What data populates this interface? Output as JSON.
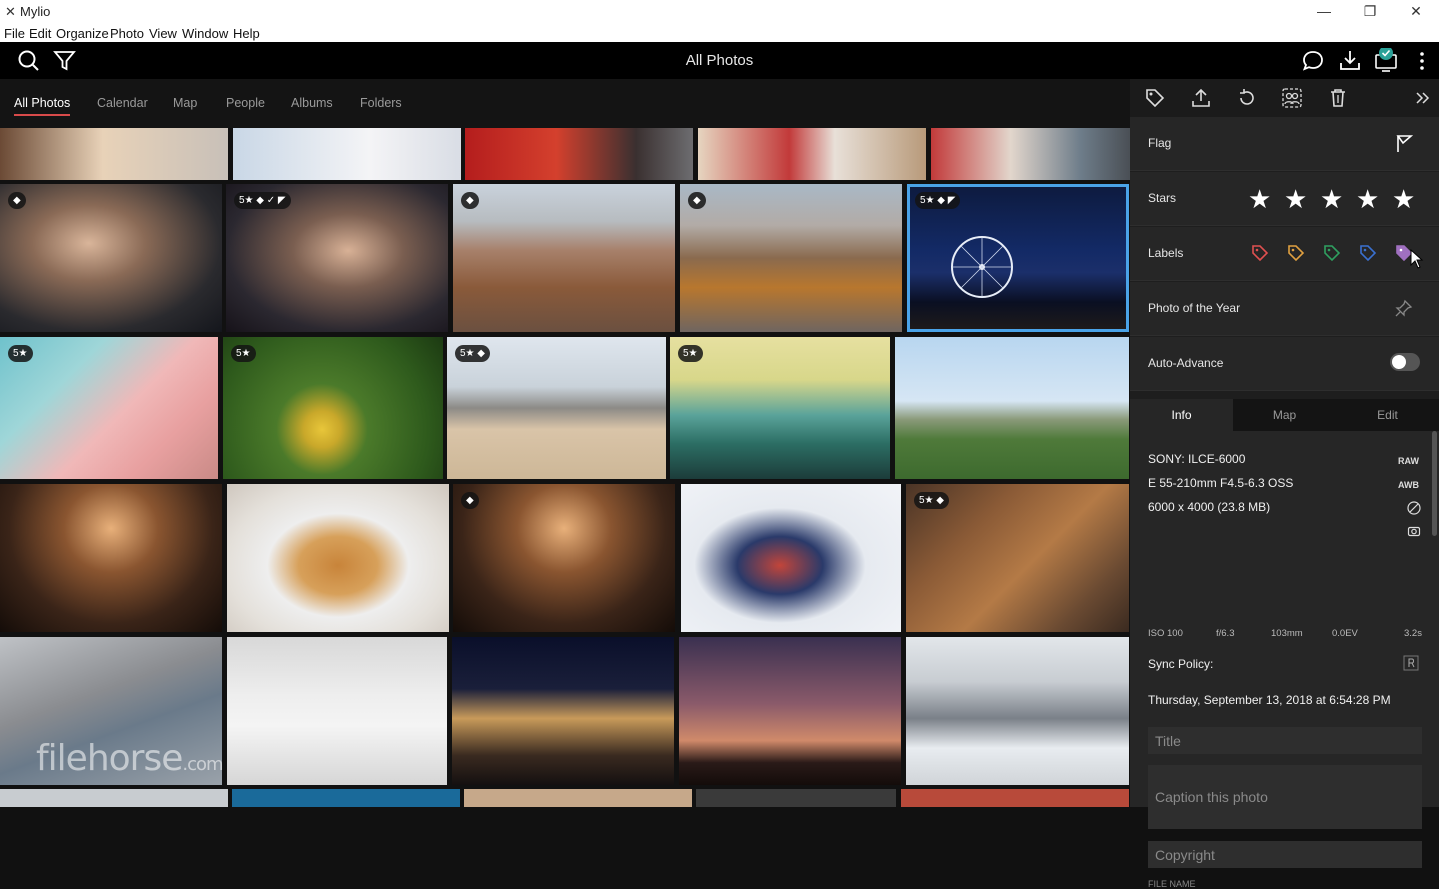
{
  "window": {
    "app_name": "Mylio",
    "minimize": "—",
    "maximize": "❐",
    "close": "✕"
  },
  "menu": [
    "File",
    "Edit",
    "Organize",
    "Photo",
    "View",
    "Window",
    "Help"
  ],
  "header": {
    "title": "All Photos"
  },
  "tabs": [
    "All Photos",
    "Calendar",
    "Map",
    "People",
    "Albums",
    "Folders"
  ],
  "panel": {
    "flag_label": "Flag",
    "stars_label": "Stars",
    "labels_label": "Labels",
    "poty_label": "Photo of the Year",
    "auto_advance_label": "Auto-Advance",
    "label_colors": [
      "#e05050",
      "#e0a040",
      "#2fa060",
      "#3a70d0",
      "#a070c0"
    ],
    "subtabs": [
      "Info",
      "Map",
      "Edit"
    ],
    "info": {
      "camera": "SONY: ILCE-6000",
      "lens": "E 55-210mm F4.5-6.3 OSS",
      "resolution": "6000 x 4000 (23.8 MB)",
      "raw": "RAW",
      "awb": "AWB",
      "iso": "ISO 100",
      "fstop": "f/6.3",
      "focal": "103mm",
      "ev": "0.0EV",
      "shutter": "3.2s",
      "sync_label": "Sync Policy:",
      "date": "Thursday, September 13, 2018 at 6:54:28 PM",
      "title_placeholder": "Title",
      "caption_placeholder": "Caption this photo",
      "copyright_placeholder": "Copyright",
      "filename_label": "FILE NAME"
    }
  },
  "badges": {
    "r1c2": "5★ ◆ ✓ ◤",
    "r1c5": "5★ ◆ ◤",
    "r2c1": "5★",
    "r2c2": "5★",
    "r2c3": "5★ ◆",
    "r2c4": "5★",
    "r3c5": "5★ ◆",
    "tag_only": "◆"
  },
  "watermark": {
    "brand": "filehorse",
    "domain": ".com"
  }
}
